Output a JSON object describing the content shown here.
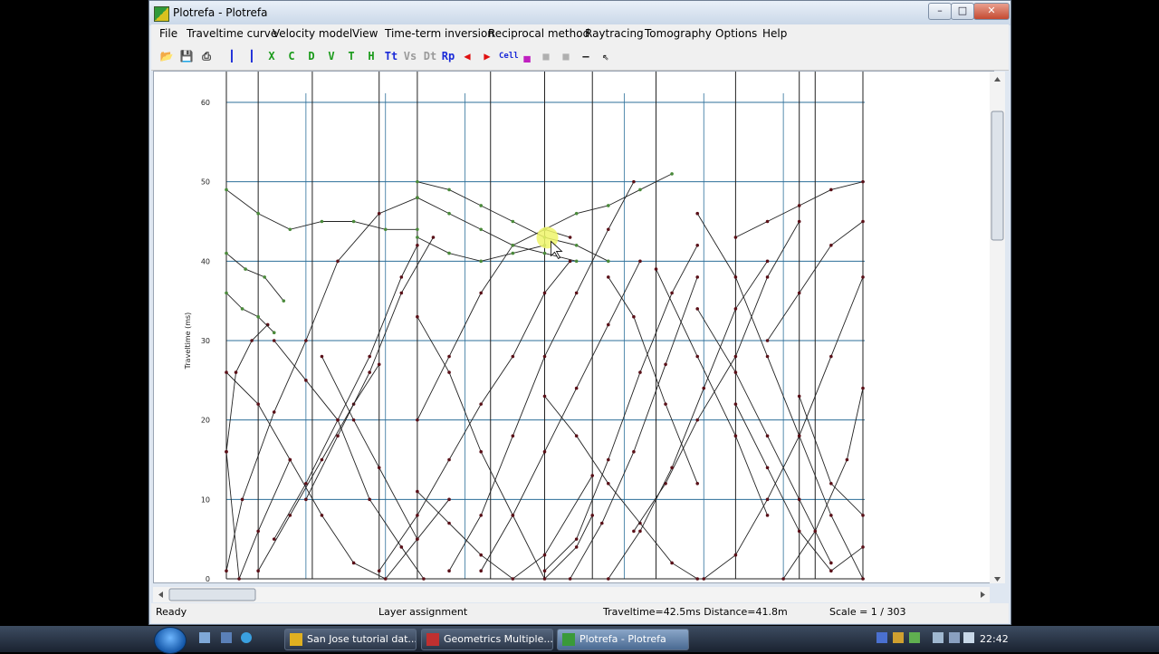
{
  "window": {
    "title": "Plotrefa - Plotrefa"
  },
  "window_buttons": {
    "minimize": "–",
    "maximize": "□",
    "close": "✕"
  },
  "menu": [
    "File",
    "Traveltime curve",
    "Velocity model",
    "View",
    "Time-term inversion",
    "Reciprocal method",
    "Raytracing",
    "Tomography",
    "Options",
    "Help"
  ],
  "toolbar": [
    {
      "name": "open-icon",
      "glyph": "📂",
      "color": "#b07a10"
    },
    {
      "name": "save-icon",
      "glyph": "💾",
      "color": "#333333"
    },
    {
      "name": "print-icon",
      "glyph": "⎙",
      "color": "#333333"
    },
    {
      "name": "shot-icon",
      "glyph": "┃",
      "color": "#1a2ad8"
    },
    {
      "name": "receiver-icon",
      "glyph": "┃",
      "color": "#1a2ad8"
    },
    {
      "name": "delete-point-icon",
      "glyph": "X",
      "color": "#1a9a1a"
    },
    {
      "name": "c-icon",
      "glyph": "C",
      "color": "#1a9a1a"
    },
    {
      "name": "d-icon",
      "glyph": "D",
      "color": "#1a9a1a"
    },
    {
      "name": "v-icon",
      "glyph": "V",
      "color": "#1a9a1a"
    },
    {
      "name": "t-icon",
      "glyph": "T",
      "color": "#1a9a1a"
    },
    {
      "name": "h-icon",
      "glyph": "H",
      "color": "#1a9a1a"
    },
    {
      "name": "tt-icon",
      "glyph": "Tt",
      "color": "#1a2ad8"
    },
    {
      "name": "vs-icon",
      "glyph": "Vs",
      "color": "#9a9a9a"
    },
    {
      "name": "dt-icon",
      "glyph": "Dt",
      "color": "#9a9a9a"
    },
    {
      "name": "rp-icon",
      "glyph": "Rp",
      "color": "#1a2ad8"
    },
    {
      "name": "previous-shot-icon",
      "glyph": "◀",
      "color": "#e01010"
    },
    {
      "name": "next-shot-icon",
      "glyph": "▶",
      "color": "#e01010"
    },
    {
      "name": "cell-icon",
      "glyph": "Cell",
      "color": "#1a2ad8"
    },
    {
      "name": "color-scale-icon",
      "glyph": "▄",
      "color": "#c020c0"
    },
    {
      "name": "gray-box-icon",
      "glyph": "■",
      "color": "#b0b0b0"
    },
    {
      "name": "gray-box-2-icon",
      "glyph": "■",
      "color": "#b0b0b0"
    },
    {
      "name": "line-icon",
      "glyph": "—",
      "color": "#222222"
    },
    {
      "name": "pointer-icon",
      "glyph": "⇖",
      "color": "#222222"
    }
  ],
  "chart_data": {
    "type": "line",
    "title": "",
    "xlabel": "",
    "ylabel": "Traveltime (ms)",
    "ylim": [
      0,
      60
    ],
    "yticks": [
      0,
      10,
      20,
      30,
      40,
      50,
      60
    ],
    "x_domain": [
      0,
      200
    ],
    "grid": true,
    "receiver_positions": [
      10,
      27,
      48,
      60,
      83,
      100,
      115,
      135,
      160,
      180,
      185,
      200
    ],
    "series": [
      {
        "color": "#5a1018",
        "x": [
          0,
          5,
          15,
          25,
          35,
          48,
          60
        ],
        "y": [
          1,
          10,
          21,
          30,
          40,
          46,
          48
        ]
      },
      {
        "color": "#5a1018",
        "x": [
          0,
          3,
          8,
          13
        ],
        "y": [
          16,
          26,
          30,
          32
        ]
      },
      {
        "color": "#5a1018",
        "x": [
          0,
          4,
          10,
          20
        ],
        "y": [
          16,
          0,
          6,
          15
        ]
      },
      {
        "color": "#5a1018",
        "x": [
          0,
          10,
          20,
          30,
          40,
          50,
          60,
          70
        ],
        "y": [
          26,
          22,
          15,
          8,
          2,
          0,
          5,
          10
        ]
      },
      {
        "color": "#5a1018",
        "x": [
          10,
          20,
          30,
          40,
          48
        ],
        "y": [
          1,
          8,
          15,
          22,
          27
        ]
      },
      {
        "color": "#5a1018",
        "x": [
          15,
          25,
          35,
          45,
          55,
          62
        ],
        "y": [
          30,
          25,
          20,
          10,
          4,
          0
        ]
      },
      {
        "color": "#5a1018",
        "x": [
          15,
          25,
          35,
          45,
          55,
          60
        ],
        "y": [
          5,
          12,
          20,
          28,
          38,
          42
        ]
      },
      {
        "color": "#5a1018",
        "x": [
          25,
          35,
          45,
          55,
          65
        ],
        "y": [
          10,
          18,
          26,
          36,
          43
        ]
      },
      {
        "color": "#5a1018",
        "x": [
          30,
          40,
          48,
          60
        ],
        "y": [
          28,
          20,
          14,
          5
        ]
      },
      {
        "color": "#5a1018",
        "x": [
          48,
          60,
          70,
          80,
          90,
          100,
          108
        ],
        "y": [
          1,
          8,
          15,
          22,
          28,
          36,
          40
        ]
      },
      {
        "color": "#5a1018",
        "x": [
          60,
          70,
          80,
          90,
          100,
          108
        ],
        "y": [
          20,
          28,
          36,
          42,
          44,
          43
        ]
      },
      {
        "color": "#5a1018",
        "x": [
          60,
          70,
          80,
          90,
          100,
          110,
          115
        ],
        "y": [
          33,
          26,
          16,
          8,
          0,
          4,
          8
        ]
      },
      {
        "color": "#5a1018",
        "x": [
          60,
          70,
          80,
          90,
          100,
          115
        ],
        "y": [
          11,
          7,
          3,
          0,
          3,
          13
        ]
      },
      {
        "color": "#5a1018",
        "x": [
          70,
          80,
          90,
          100,
          110,
          120,
          128
        ],
        "y": [
          1,
          8,
          18,
          28,
          36,
          44,
          50
        ]
      },
      {
        "color": "#5a1018",
        "x": [
          80,
          90,
          100,
          110,
          120,
          130
        ],
        "y": [
          1,
          8,
          16,
          24,
          32,
          40
        ]
      },
      {
        "color": "#5a1018",
        "x": [
          100,
          110,
          120,
          130,
          140,
          148
        ],
        "y": [
          1,
          5,
          15,
          26,
          36,
          42
        ]
      },
      {
        "color": "#5a1018",
        "x": [
          108,
          118,
          128,
          138,
          148
        ],
        "y": [
          0,
          7,
          16,
          27,
          38
        ]
      },
      {
        "color": "#5a1018",
        "x": [
          100,
          110,
          120,
          130,
          140,
          148
        ],
        "y": [
          23,
          18,
          12,
          7,
          2,
          0
        ]
      },
      {
        "color": "#5a1018",
        "x": [
          120,
          128,
          138,
          148
        ],
        "y": [
          38,
          33,
          22,
          12
        ]
      },
      {
        "color": "#5a1018",
        "x": [
          135,
          148,
          160,
          170
        ],
        "y": [
          39,
          28,
          18,
          8
        ]
      },
      {
        "color": "#5a1018",
        "x": [
          128,
          138,
          148,
          160,
          170,
          180
        ],
        "y": [
          6,
          12,
          20,
          28,
          38,
          45
        ]
      },
      {
        "color": "#5a1018",
        "x": [
          120,
          130,
          140,
          150,
          160,
          170
        ],
        "y": [
          0,
          6,
          14,
          24,
          34,
          40
        ]
      },
      {
        "color": "#5a1018",
        "x": [
          148,
          160,
          170,
          180,
          190,
          200
        ],
        "y": [
          46,
          38,
          28,
          18,
          8,
          0
        ]
      },
      {
        "color": "#5a1018",
        "x": [
          148,
          160,
          170,
          180,
          190
        ],
        "y": [
          34,
          26,
          18,
          10,
          2
        ]
      },
      {
        "color": "#5a1018",
        "x": [
          160,
          170,
          180,
          190,
          200
        ],
        "y": [
          22,
          14,
          6,
          1,
          4
        ]
      },
      {
        "color": "#5a1018",
        "x": [
          150,
          160,
          170,
          180,
          190,
          200
        ],
        "y": [
          0,
          3,
          10,
          18,
          28,
          38
        ]
      },
      {
        "color": "#5a1018",
        "x": [
          175,
          185,
          195,
          200
        ],
        "y": [
          0,
          6,
          15,
          24
        ]
      },
      {
        "color": "#5a1018",
        "x": [
          170,
          180,
          190,
          200
        ],
        "y": [
          30,
          36,
          42,
          45
        ]
      },
      {
        "color": "#5a1018",
        "x": [
          180,
          190,
          200
        ],
        "y": [
          23,
          12,
          8
        ]
      },
      {
        "color": "#5a1018",
        "x": [
          160,
          170,
          180,
          190,
          200
        ],
        "y": [
          43,
          45,
          47,
          49,
          50
        ]
      },
      {
        "color": "#4a8a3a",
        "x": [
          0,
          10,
          20,
          30,
          40,
          50,
          60
        ],
        "y": [
          49,
          46,
          44,
          45,
          45,
          44,
          44
        ]
      },
      {
        "color": "#4a8a3a",
        "x": [
          0,
          6,
          12,
          18
        ],
        "y": [
          41,
          39,
          38,
          35
        ]
      },
      {
        "color": "#4a8a3a",
        "x": [
          0,
          5,
          10,
          15
        ],
        "y": [
          36,
          34,
          33,
          31
        ]
      },
      {
        "color": "#4a8a3a",
        "x": [
          60,
          70,
          80,
          90,
          100,
          110,
          120
        ],
        "y": [
          50,
          49,
          47,
          45,
          43,
          42,
          40
        ]
      },
      {
        "color": "#4a8a3a",
        "x": [
          60,
          70,
          80,
          90,
          100,
          110
        ],
        "y": [
          48,
          46,
          44,
          42,
          41,
          40
        ]
      },
      {
        "color": "#4a8a3a",
        "x": [
          60,
          70,
          80,
          90,
          100
        ],
        "y": [
          43,
          41,
          40,
          41,
          42
        ]
      },
      {
        "color": "#4a8a3a",
        "x": [
          100,
          110,
          120,
          130,
          140
        ],
        "y": [
          44,
          46,
          47,
          49,
          51
        ]
      }
    ]
  },
  "status": {
    "ready": "Ready",
    "mode": "Layer assignment",
    "readout": "Traveltime=42.5ms  Distance=41.8m",
    "scale": "Scale = 1 / 303"
  },
  "taskbar": {
    "items": [
      {
        "label": "San Jose tutorial dat...",
        "color": "#e0b020"
      },
      {
        "label": "Geometrics Multiple...",
        "color": "#c03030"
      },
      {
        "label": "Plotrefa - Plotrefa",
        "color": "#3a9a3a"
      }
    ],
    "clock": "22:42"
  }
}
